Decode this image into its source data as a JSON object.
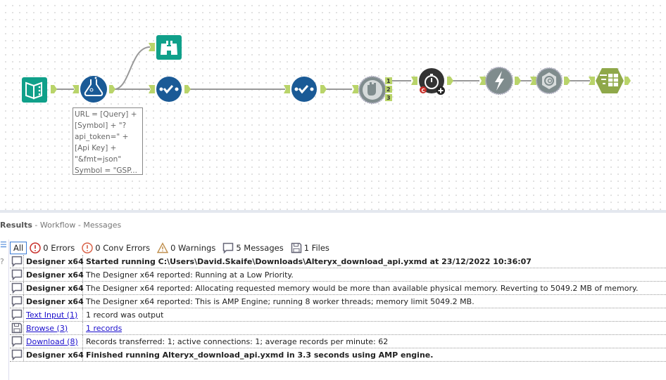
{
  "canvas": {
    "annotation": "URL = [Query] +\n[Symbol] + \"?\napi_token=\" +\n[Api Key] +\n\"&fmt=json\"\nSymbol = \"GSP...",
    "filter_outputs": [
      "1",
      "2",
      "3"
    ],
    "timer_badge": "C"
  },
  "results": {
    "title": "Results",
    "breadcrumb": " - Workflow - Messages",
    "filters": {
      "all": "All",
      "errors": "0 Errors",
      "conv_errors": "0 Conv Errors",
      "warnings": "0 Warnings",
      "messages": "5 Messages",
      "files": "1 Files"
    },
    "rows": [
      {
        "tool": "Designer x64",
        "msg": "Started running C:\\Users\\David.Skaife\\Downloads\\Alteryx_download_api.yxmd at 23/12/2022 10:36:07"
      },
      {
        "tool": "Designer x64",
        "msg": "The Designer x64 reported: Running at a Low Priority."
      },
      {
        "tool": "Designer x64",
        "msg": "The Designer x64 reported: Allocating requested memory would be more than available physical memory. Reverting to 5049.2 MB of memory."
      },
      {
        "tool": "Designer x64",
        "msg": "The Designer x64 reported: This is AMP Engine; running 8 worker threads; memory limit 5049.2 MB."
      },
      {
        "tool": "Text Input (1)",
        "msg": "1 record was output"
      },
      {
        "tool": "Browse (3)",
        "msg": "1 records"
      },
      {
        "tool": "Download (8)",
        "msg": "Records transferred: 1; active connections: 1; average records per minute: 62"
      },
      {
        "tool": "Designer x64",
        "msg": "Finished running Alteryx_download_api.yxmd in 3.3 seconds using AMP engine."
      }
    ]
  },
  "colors": {
    "teal": "#10a08a",
    "blue": "#1a5a96",
    "gray": "#7f8c8d",
    "olive": "#8fa84a",
    "anchor": "#b9d46a"
  }
}
